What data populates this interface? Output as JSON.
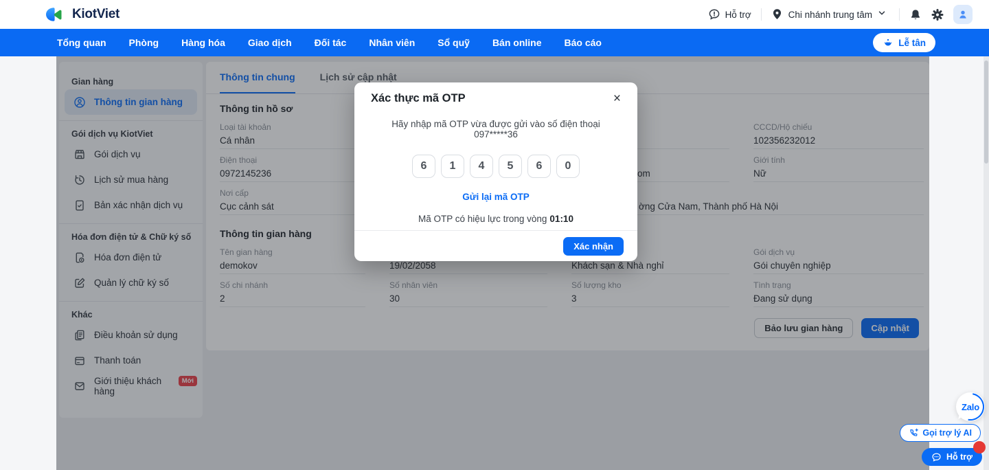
{
  "colors": {
    "brand_blue": "#0a6af3",
    "accent_blue": "#0b6cf5",
    "badge_red": "#ec4049"
  },
  "header": {
    "brand": "KiotViet",
    "support": "Hỗ trợ",
    "branch": "Chi nhánh trung tâm"
  },
  "nav": {
    "items": [
      "Tổng quan",
      "Phòng",
      "Hàng hóa",
      "Giao dịch",
      "Đối tác",
      "Nhân viên",
      "Sổ quỹ",
      "Bán online",
      "Báo cáo"
    ],
    "reception": "Lễ tân"
  },
  "sidebar": {
    "group1_title": "Gian hàng",
    "item_info": "Thông tin gian hàng",
    "group2_title": "Gói dịch vụ KiotViet",
    "item_package": "Gói dịch vụ",
    "item_history": "Lịch sử mua hàng",
    "item_confirmation": "Bản xác nhận dịch vụ",
    "group3_title": "Hóa đơn điện tử & Chữ ký số",
    "item_einvoice": "Hóa đơn điện tử",
    "item_signature": "Quản lý chữ ký số",
    "group4_title": "Khác",
    "item_terms": "Điều khoản sử dụng",
    "item_payment": "Thanh toán",
    "item_referral": "Giới thiệu khách hàng",
    "referral_badge": "Mới"
  },
  "main": {
    "tab_general": "Thông tin chung",
    "tab_history": "Lịch sử cập nhật",
    "profile": {
      "title": "Thông tin hồ sơ",
      "account_type_label": "Loại tài khoản",
      "account_type": "Cá nhân",
      "phone_label": "Điện thoại",
      "phone": "0972145236",
      "issued_label": "Nơi cấp",
      "issued": "Cục cảnh sát",
      "id_label": "CCCD/Hộ chiếu",
      "id_number": "102356232012",
      "gender_label": "Giới tính",
      "gender": "Nữ",
      "email_fragment": "om",
      "address_fragment": "ờng Cửa Nam, Thành phố Hà Nội"
    },
    "store": {
      "title": "Thông tin gian hàng",
      "name_label": "Tên gian hàng",
      "name": "demokov",
      "expiry": "19/02/2058",
      "industry": "Khách sạn & Nhà nghỉ",
      "package_label": "Gói dịch vụ",
      "package": "Gói chuyên nghiệp",
      "branches_label": "Số chi nhánh",
      "branches": "2",
      "staff_label": "Số nhân viên",
      "staff": "30",
      "warehouses_label": "Số lượng kho",
      "warehouses": "3",
      "status_label": "Tình trạng",
      "status": "Đang sử dụng"
    },
    "archive_button": "Bảo lưu gian hàng",
    "update_button": "Cập nhật"
  },
  "modal": {
    "title": "Xác thực mã OTP",
    "close_glyph": "×",
    "message": "Hãy nhập mã OTP vừa được gửi vào số điện thoại 097*****36",
    "otp_digits": [
      "6",
      "1",
      "4",
      "5",
      "6",
      "0"
    ],
    "resend": "Gửi lại mã OTP",
    "expiry_prefix": "Mã OTP có hiệu lực trong vòng",
    "expiry_time": "01:10",
    "confirm": "Xác nhận"
  },
  "floating": {
    "zalo": "Zalo",
    "ai_call": "Gọi trợ lý AI",
    "support": "Hỗ trợ"
  }
}
